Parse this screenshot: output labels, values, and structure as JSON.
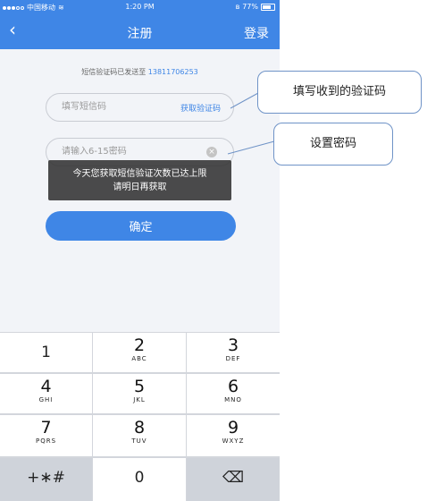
{
  "status": {
    "carrier": "中国移动",
    "time": "1:20 PM",
    "battery": "77%",
    "battery_level": 0.77
  },
  "nav": {
    "back_glyph": "‹",
    "title": "注册",
    "login": "登录"
  },
  "form": {
    "sent_prefix": "短信验证码已发送至",
    "phone_number": "13811706253",
    "sms_placeholder": "填写短信码",
    "get_code": "获取验证码",
    "password_placeholder": "请输入6-15密码",
    "clear_glyph": "×",
    "confirm": "确定"
  },
  "toast": {
    "line1": "今天您获取短信验证次数已达上限",
    "line2": "请明日再获取"
  },
  "keypad": {
    "keys": [
      {
        "num": "1",
        "letters": ""
      },
      {
        "num": "2",
        "letters": "ABC"
      },
      {
        "num": "3",
        "letters": "DEF"
      },
      {
        "num": "4",
        "letters": "GHI"
      },
      {
        "num": "5",
        "letters": "JKL"
      },
      {
        "num": "6",
        "letters": "MNO"
      },
      {
        "num": "7",
        "letters": "PQRS"
      },
      {
        "num": "8",
        "letters": "TUV"
      },
      {
        "num": "9",
        "letters": "WXYZ"
      }
    ],
    "symbols": "+∗#",
    "zero": "0",
    "delete_glyph": "⌫"
  },
  "callouts": {
    "sms_hint": "填写收到的验证码",
    "password_hint": "设置密码"
  },
  "colors": {
    "accent": "#3f86e6",
    "background": "#f2f4f8",
    "toast": "#323232"
  }
}
